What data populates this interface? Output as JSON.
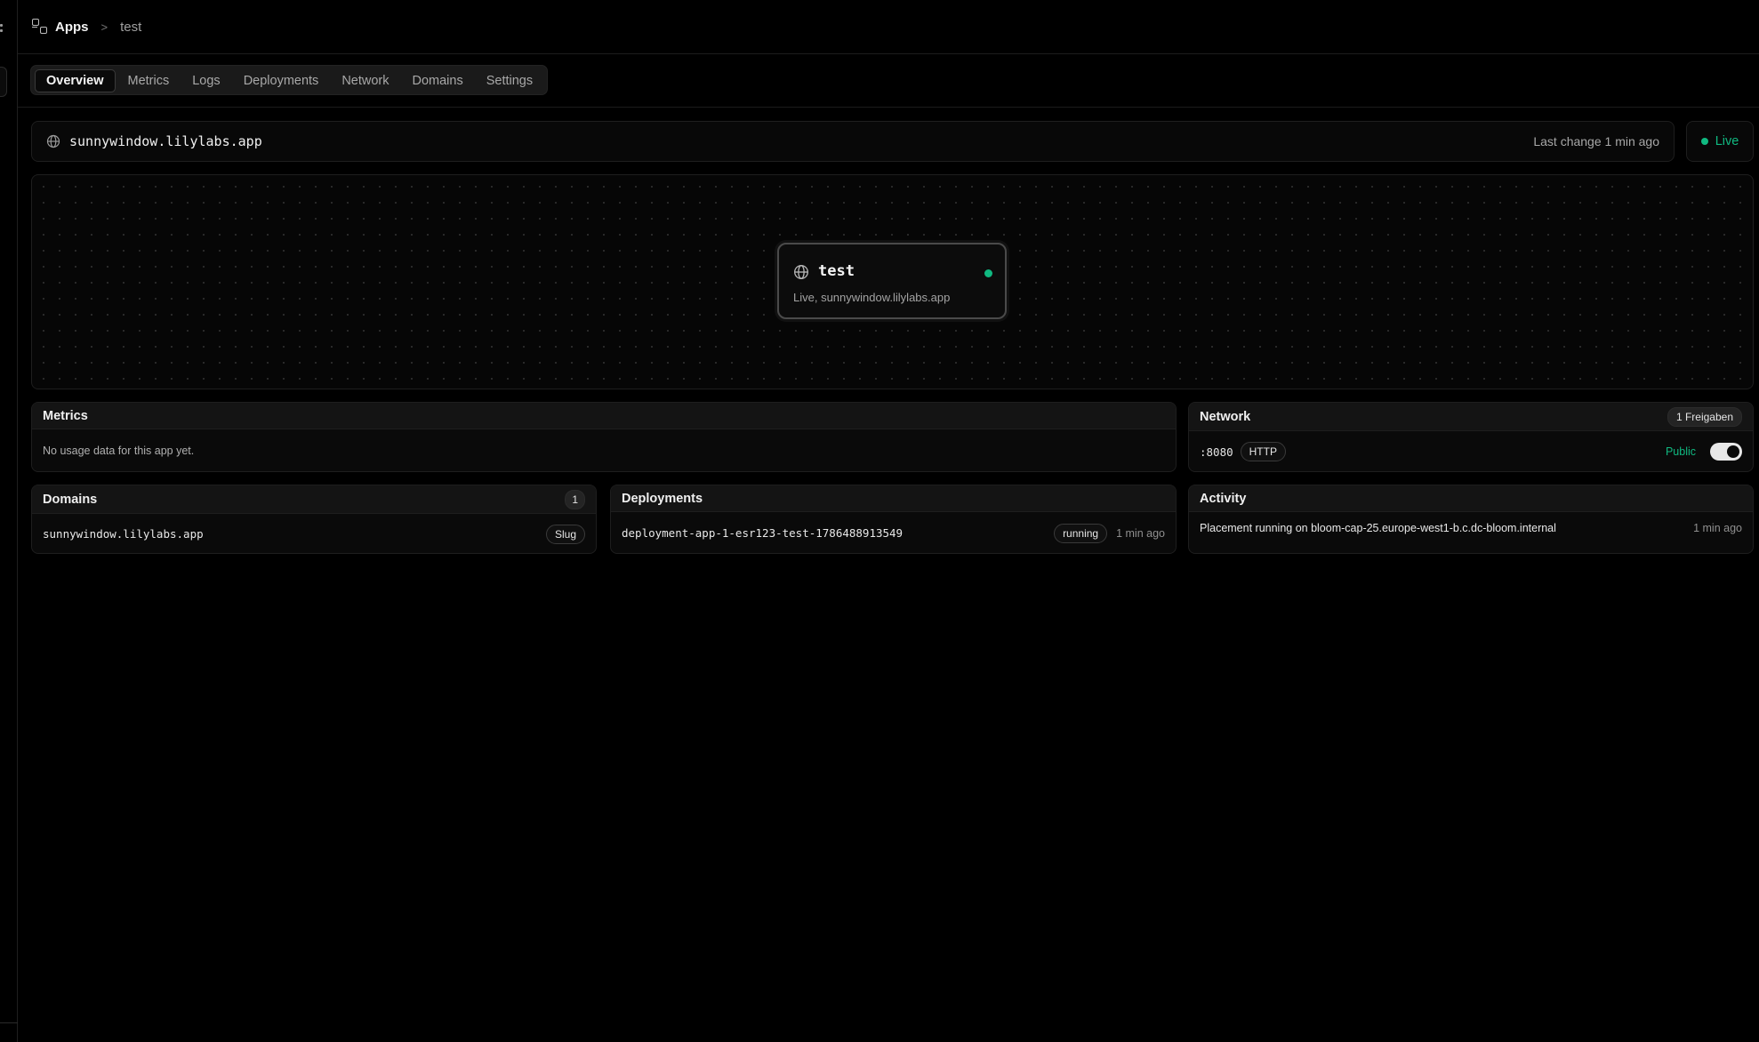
{
  "breadcrumb": {
    "apps_label": "Apps",
    "separator": ">",
    "current": "test"
  },
  "tabs": [
    {
      "label": "Overview",
      "active": true
    },
    {
      "label": "Metrics",
      "active": false
    },
    {
      "label": "Logs",
      "active": false
    },
    {
      "label": "Deployments",
      "active": false
    },
    {
      "label": "Network",
      "active": false
    },
    {
      "label": "Domains",
      "active": false
    },
    {
      "label": "Settings",
      "active": false
    }
  ],
  "url_bar": {
    "url": "sunnywindow.lilylabs.app",
    "last_change": "Last change 1 min ago",
    "status": "Live",
    "status_color": "#10b981"
  },
  "canvas_node": {
    "title": "test",
    "subtitle": "Live, sunnywindow.lilylabs.app",
    "status_color": "#10b981"
  },
  "metrics": {
    "title": "Metrics",
    "empty_text": "No usage data for this app yet."
  },
  "network": {
    "title": "Network",
    "badge": "1 Freigaben",
    "port": ":8080",
    "protocol": "HTTP",
    "visibility": "Public",
    "visibility_color": "#10b981",
    "public_enabled": true
  },
  "domains": {
    "title": "Domains",
    "count": "1",
    "items": [
      {
        "domain": "sunnywindow.lilylabs.app",
        "tag": "Slug"
      }
    ]
  },
  "deployments": {
    "title": "Deployments",
    "items": [
      {
        "id": "deployment-app-1-esr123-test-1786488913549",
        "status": "running",
        "time": "1 min ago"
      }
    ]
  },
  "activity": {
    "title": "Activity",
    "items": [
      {
        "text": "Placement running on bloom-cap-25.europe-west1-b.c.dc-bloom.internal",
        "time": "1 min ago"
      }
    ]
  }
}
